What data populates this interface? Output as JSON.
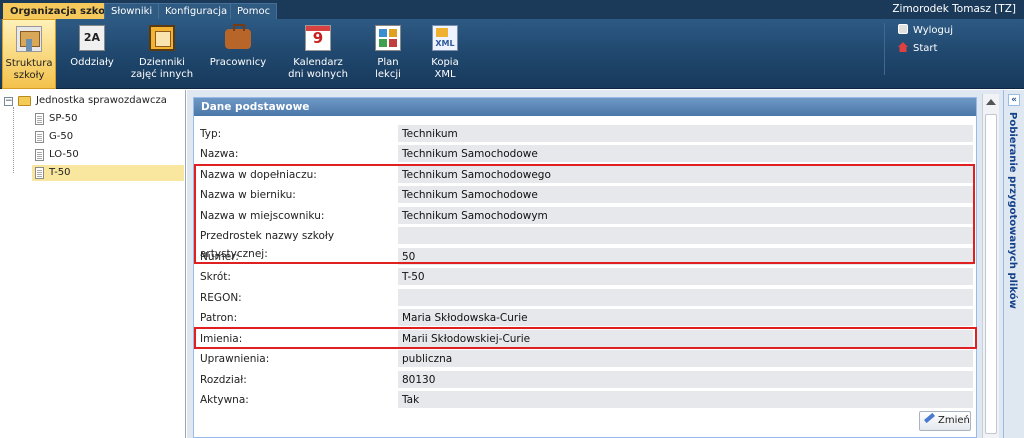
{
  "tabs": [
    {
      "label": "Organizacja szkoły",
      "active": true
    },
    {
      "label": "Słowniki",
      "active": false
    },
    {
      "label": "Konfiguracja",
      "active": false
    },
    {
      "label": "Pomoc",
      "active": false
    }
  ],
  "user": {
    "name": "Zimorodek Tomasz [TZ]"
  },
  "toolbar": {
    "buttons": [
      {
        "label": "Struktura szkoły",
        "icon": "school-structure-icon",
        "active": true
      },
      {
        "label": "Oddziały",
        "icon": "class-2a-icon",
        "icon_text": "2A"
      },
      {
        "label": "Dzienniki zajęć innych",
        "icon": "journal-film-icon"
      },
      {
        "label": "Pracownicy",
        "icon": "briefcase-icon"
      },
      {
        "label": "Kalendarz dni wolnych",
        "icon": "calendar-icon",
        "icon_text": "9"
      },
      {
        "label": "Plan lekcji",
        "icon": "timetable-icon"
      },
      {
        "label": "Kopia XML",
        "icon": "xml-copy-icon",
        "icon_text": "XML"
      }
    ],
    "logout_label": "Wyloguj",
    "start_label": "Start"
  },
  "tree": {
    "root": "Jednostka sprawozdawcza",
    "children": [
      "SP-50",
      "G-50",
      "LO-50",
      "T-50"
    ],
    "selected": "T-50"
  },
  "panel": {
    "title": "Dane podstawowe",
    "fields": [
      {
        "label": "Typ:",
        "value": "Technikum"
      },
      {
        "label": "Nazwa:",
        "value": "Technikum Samochodowe"
      },
      {
        "label": "Nazwa w dopełniaczu:",
        "value": "Technikum Samochodowego"
      },
      {
        "label": "Nazwa w bierniku:",
        "value": "Technikum Samochodowe"
      },
      {
        "label": "Nazwa w miejscowniku:",
        "value": "Technikum Samochodowym"
      },
      {
        "label": "Przedrostek nazwy szkoły artystycznej:",
        "value": ""
      },
      {
        "label": "Numer:",
        "value": "50"
      },
      {
        "label": "Skrót:",
        "value": "T-50"
      },
      {
        "label": "REGON:",
        "value": ""
      },
      {
        "label": "Patron:",
        "value": "Maria Skłodowska-Curie"
      },
      {
        "label": "Imienia:",
        "value": "Marii Skłodowskiej-Curie"
      },
      {
        "label": "Uprawnienia:",
        "value": "publiczna"
      },
      {
        "label": "Rozdział:",
        "value": "80130"
      },
      {
        "label": "Aktywna:",
        "value": "Tak"
      }
    ],
    "edit_label": "Zmień"
  },
  "right_panel": {
    "label": "Pobieranie przygotowanych plików",
    "collapse_glyph": "«"
  },
  "colors": {
    "highlight": "#e02020",
    "accent": "#f5c95c",
    "toolbar": "#1f466c"
  }
}
